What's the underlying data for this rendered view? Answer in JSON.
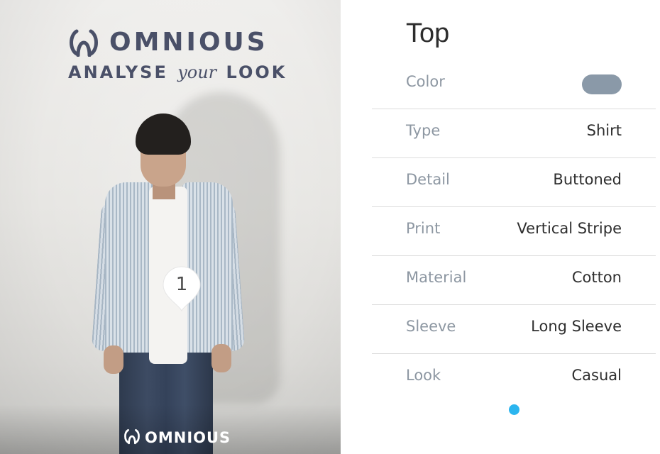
{
  "photo": {
    "brand_name": "OMNIOUS",
    "tagline_before": "ANALYSE",
    "tagline_your": "your",
    "tagline_after": "LOOK",
    "marker_label": "1",
    "watermark_name": "OMNIOUS"
  },
  "panel": {
    "title": "Top",
    "color": {
      "label": "Color",
      "swatch": "#8a99a8"
    },
    "rows": [
      {
        "label": "Type",
        "value": "Shirt"
      },
      {
        "label": "Detail",
        "value": "Buttoned"
      },
      {
        "label": "Print",
        "value": "Vertical Stripe"
      },
      {
        "label": "Material",
        "value": "Cotton"
      },
      {
        "label": "Sleeve",
        "value": "Long Sleeve"
      },
      {
        "label": "Look",
        "value": "Casual"
      }
    ],
    "page_dot_color": "#2bb5ef"
  }
}
